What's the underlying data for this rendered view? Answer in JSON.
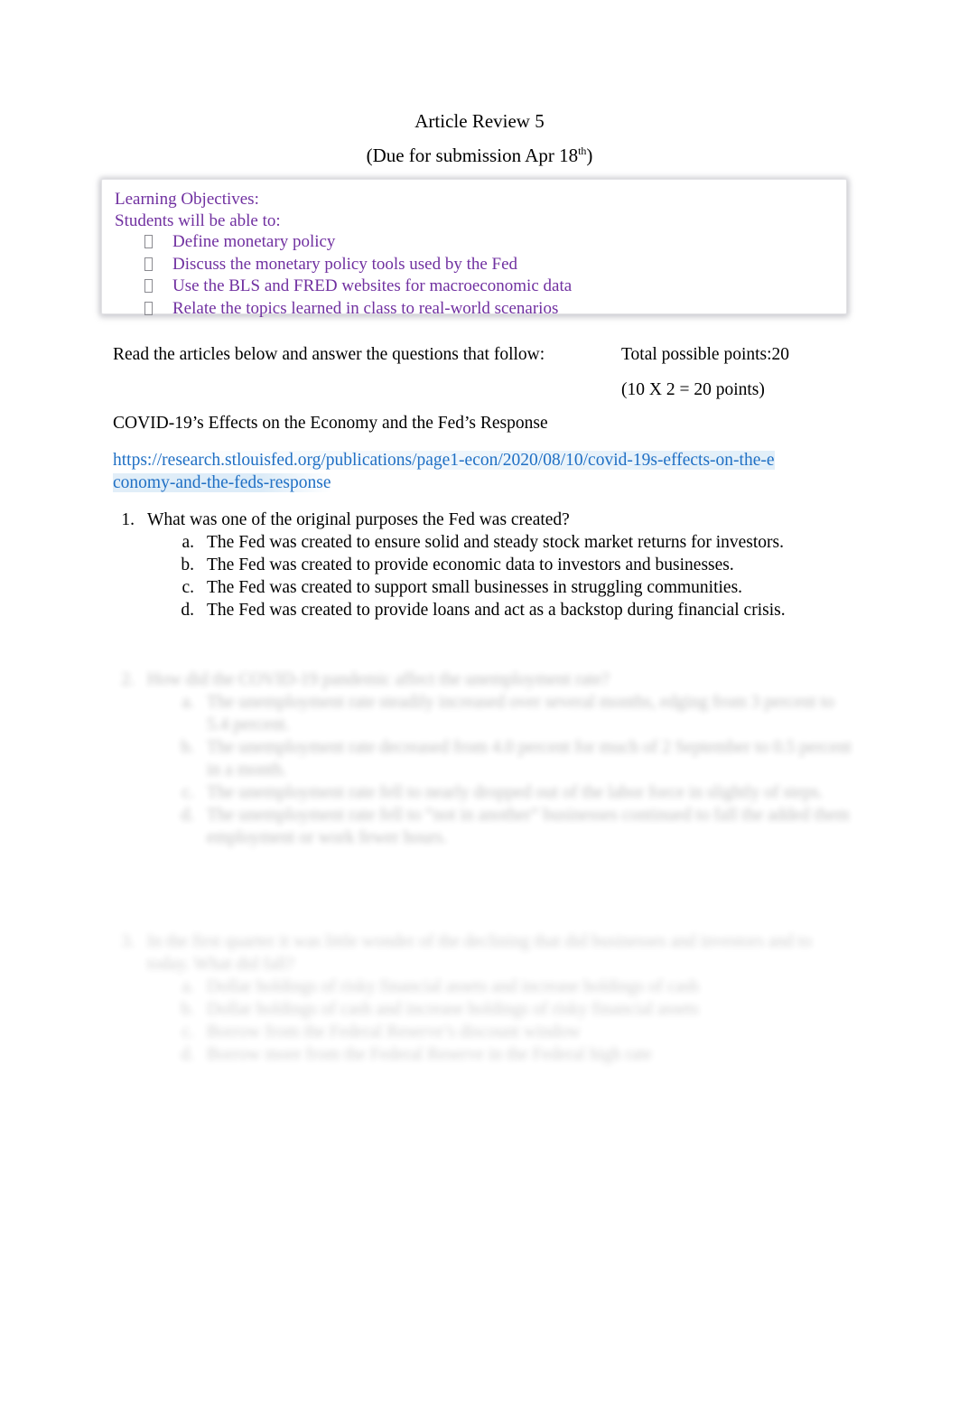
{
  "document": {
    "title": "Article Review 5",
    "subtitle_prefix": "(Due for submission Apr 18",
    "subtitle_sup": "th",
    "subtitle_suffix": ")"
  },
  "learning_objectives": {
    "heading": "Learning Objectives:",
    "intro": "Students will be able to:",
    "bullet_glyph": "missing-glyph-box",
    "color": "#7030A0",
    "items": [
      "Define monetary policy",
      "Discuss the monetary policy tools used by the Fed",
      "Use the BLS and FRED websites for macroeconomic data",
      "Relate the topics learned in class to real-world scenarios"
    ]
  },
  "instructions": {
    "read_line": "Read the articles below and answer the questions that follow:",
    "total_points": "Total possible points:20",
    "points_breakdown": "(10 X 2 = 20 points)"
  },
  "article": {
    "heading": "COVID-19’s Effects on the Economy and the Fed’s Response",
    "url_text": "https://research.stlouisfed.org/publications/page1-econ/2020/08/10/covid-19s-effects-on-the-economy-and-the-feds-response",
    "url_color": "#1F6FC4"
  },
  "questions": [
    {
      "number": "1.",
      "text": "What was one of the original purposes the Fed was created?",
      "state": "legible",
      "options": [
        {
          "letter": "a.",
          "text": "The Fed was created to ensure solid and steady stock market returns for investors."
        },
        {
          "letter": "b.",
          "text": "The Fed was created to provide economic data to investors and businesses."
        },
        {
          "letter": "c.",
          "text": "The Fed was created to support small businesses in struggling communities."
        },
        {
          "letter": "d.",
          "text": "The Fed was created to provide loans and act as a backstop during financial crisis."
        }
      ]
    },
    {
      "number": "2.",
      "text": "How did the COVID-19 pandemic affect the unemployment rate?",
      "state": "blurred",
      "options": [
        {
          "letter": "a.",
          "text": "The unemployment rate steadily increased over several months, edging from 3 percent to 5.4 percent."
        },
        {
          "letter": "b.",
          "text": "The unemployment rate decreased from 4.0 percent for much of 2 September to 0.5 percent in a month."
        },
        {
          "letter": "c.",
          "text": "The unemployment rate fell to nearly dropped out of the labor force in slightly of steps."
        },
        {
          "letter": "d.",
          "text": "The unemployment rate fell to “not in another” businesses continued to fall the added them employment or work fewer hours."
        }
      ]
    },
    {
      "number": "3.",
      "text": "In the first quarter it was little wonder of the declining that did businesses and investors and to today. What did fall?",
      "state": "blurred",
      "options": [
        {
          "letter": "a.",
          "text": "Dollar holdings of risky financial assets and increase holdings of cash"
        },
        {
          "letter": "b.",
          "text": "Dollar holdings of cash and increase holdings of risky financial assets"
        },
        {
          "letter": "c.",
          "text": "Borrow from the Federal Reserve’s discount window"
        },
        {
          "letter": "d.",
          "text": "Borrow more from the Federal Reserve in the Federal high rate"
        }
      ]
    }
  ]
}
